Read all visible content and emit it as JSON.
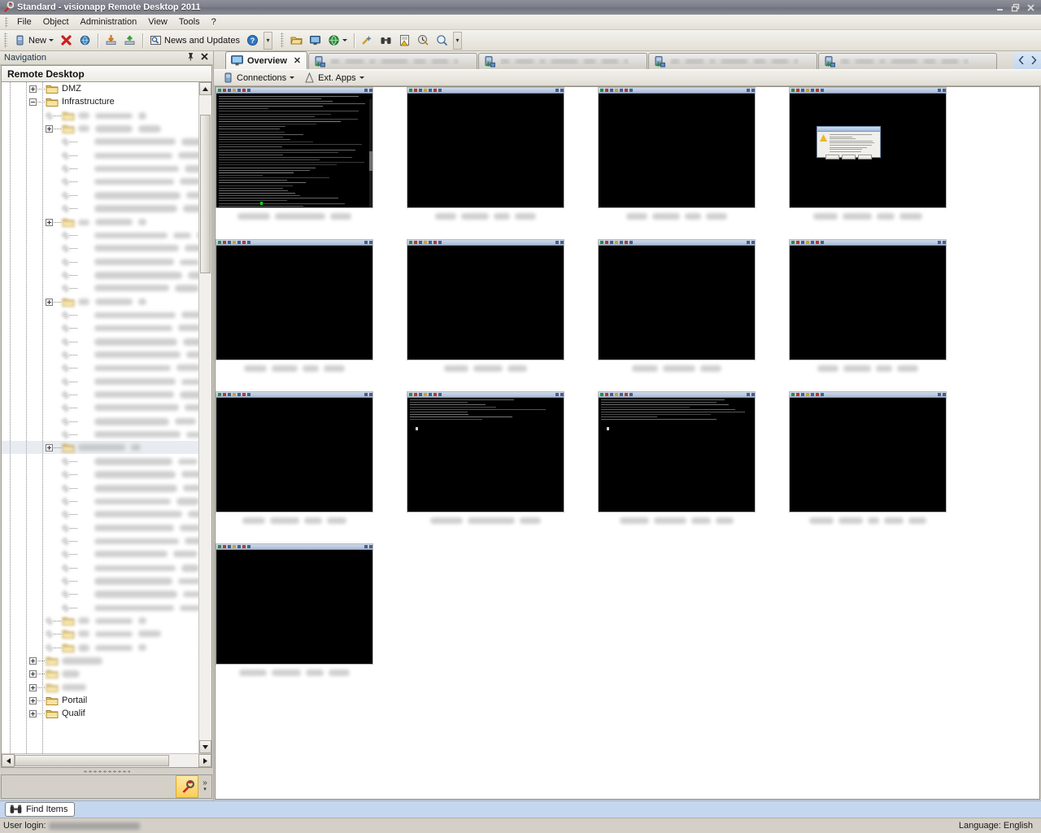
{
  "window": {
    "title": "Standard - visionapp Remote Desktop 2011",
    "app_icon": "wrench-icon",
    "buttons": {
      "minimize": "–",
      "restore": "❐",
      "close": "✕"
    }
  },
  "menubar": {
    "items": [
      {
        "label": "File"
      },
      {
        "label": "Object"
      },
      {
        "label": "Administration"
      },
      {
        "label": "View"
      },
      {
        "label": "Tools"
      },
      {
        "label": "?"
      }
    ]
  },
  "toolbar": {
    "groups": [
      {
        "buttons": [
          {
            "label": "New",
            "icon": "server-new-icon",
            "dropdown": true
          },
          {
            "label": "",
            "icon": "delete-red-x-icon"
          },
          {
            "label": "",
            "icon": "refresh-globe-icon"
          },
          {
            "label": "",
            "icon": "import-down-icon"
          },
          {
            "label": "",
            "icon": "export-up-icon"
          },
          {
            "label": "News and Updates",
            "icon": "news-magnifier-icon"
          },
          {
            "label": "",
            "icon": "help-question-icon"
          }
        ]
      },
      {
        "buttons": [
          {
            "label": "",
            "icon": "folder-open-icon"
          },
          {
            "label": "",
            "icon": "monitor-icon"
          },
          {
            "label": "",
            "icon": "globe-icon",
            "dropdown": true
          },
          {
            "label": "",
            "icon": "tools-wand-icon"
          },
          {
            "label": "",
            "icon": "binoculars-icon"
          },
          {
            "label": "",
            "icon": "report-warning-icon"
          },
          {
            "label": "",
            "icon": "history-clock-icon"
          },
          {
            "label": "",
            "icon": "search-globe-icon"
          }
        ]
      }
    ],
    "overflow_label": "»"
  },
  "navigation": {
    "caption": "Navigation",
    "pin_icon": "pin-icon",
    "close_icon": "close-icon",
    "header": "Remote Desktop",
    "tree": [
      {
        "id": "dmz",
        "label": "DMZ",
        "indent": 1,
        "expander": "plus",
        "icon": "folder-icon",
        "redacted": false
      },
      {
        "id": "infrastructure",
        "label": "Infrastructure",
        "indent": 1,
        "expander": "minus",
        "icon": "folder-icon",
        "redacted": false
      },
      {
        "id": "r1",
        "indent": 2,
        "expander": "none",
        "icon": "folder-yellow-icon",
        "redacted": true,
        "blobs": [
          14,
          46,
          10
        ]
      },
      {
        "id": "r2",
        "indent": 2,
        "expander": "plus",
        "icon": "folder-yellow-icon",
        "redacted": true,
        "blobs": [
          14,
          46,
          28
        ]
      },
      {
        "id": "r3",
        "indent": 3,
        "expander": "none",
        "icon": "connection-icon",
        "redacted": true,
        "blobs": [
          100,
          28
        ]
      },
      {
        "id": "r4",
        "indent": 3,
        "expander": "none",
        "icon": "connection-icon",
        "redacted": true,
        "blobs": [
          96,
          30
        ]
      },
      {
        "id": "r5",
        "indent": 3,
        "expander": "none",
        "icon": "connection-icon",
        "redacted": true,
        "blobs": [
          104,
          24
        ]
      },
      {
        "id": "r6",
        "indent": 3,
        "expander": "none",
        "icon": "connection-icon",
        "redacted": true,
        "blobs": [
          98,
          26
        ]
      },
      {
        "id": "r7",
        "indent": 3,
        "expander": "none",
        "icon": "connection-icon",
        "redacted": true,
        "blobs": [
          106,
          22
        ]
      },
      {
        "id": "r8",
        "indent": 3,
        "expander": "none",
        "icon": "connection-icon",
        "redacted": true,
        "blobs": [
          102,
          26
        ]
      },
      {
        "id": "r9",
        "indent": 2,
        "expander": "plus",
        "icon": "folder-yellow-icon",
        "redacted": true,
        "blobs": [
          14,
          46,
          10
        ]
      },
      {
        "id": "r10",
        "indent": 3,
        "expander": "none",
        "icon": "connection-icon",
        "redacted": true,
        "blobs": [
          90,
          22,
          26
        ]
      },
      {
        "id": "r11",
        "indent": 3,
        "expander": "none",
        "icon": "connection-icon",
        "redacted": true,
        "blobs": [
          104,
          22
        ]
      },
      {
        "id": "r12",
        "indent": 3,
        "expander": "none",
        "icon": "connection-icon",
        "redacted": true,
        "blobs": [
          98,
          24
        ]
      },
      {
        "id": "r13",
        "indent": 3,
        "expander": "none",
        "icon": "connection-icon",
        "redacted": true,
        "blobs": [
          108,
          20
        ]
      },
      {
        "id": "r14",
        "indent": 3,
        "expander": "none",
        "icon": "connection-icon",
        "redacted": true,
        "blobs": [
          92,
          30
        ]
      },
      {
        "id": "r15",
        "indent": 2,
        "expander": "plus",
        "icon": "folder-yellow-icon",
        "redacted": true,
        "blobs": [
          14,
          46,
          10
        ]
      },
      {
        "id": "r16",
        "indent": 3,
        "expander": "none",
        "icon": "connection-icon",
        "redacted": true,
        "blobs": [
          100,
          26
        ]
      },
      {
        "id": "r17",
        "indent": 3,
        "expander": "none",
        "icon": "connection-icon",
        "redacted": true,
        "blobs": [
          96,
          28
        ]
      },
      {
        "id": "r18",
        "indent": 3,
        "expander": "none",
        "icon": "connection-icon",
        "redacted": true,
        "blobs": [
          102,
          24
        ]
      },
      {
        "id": "r19",
        "indent": 3,
        "expander": "none",
        "icon": "connection-icon",
        "redacted": true,
        "blobs": [
          106,
          20
        ]
      },
      {
        "id": "r20",
        "indent": 3,
        "expander": "none",
        "icon": "connection-icon",
        "redacted": true,
        "blobs": [
          94,
          30
        ]
      },
      {
        "id": "r21",
        "indent": 3,
        "expander": "none",
        "icon": "connection-icon",
        "redacted": true,
        "blobs": [
          100,
          24
        ]
      },
      {
        "id": "r22",
        "indent": 3,
        "expander": "none",
        "icon": "connection-icon",
        "redacted": true,
        "blobs": [
          98,
          28
        ]
      },
      {
        "id": "r23",
        "indent": 3,
        "expander": "none",
        "icon": "connection-icon",
        "redacted": true,
        "blobs": [
          104,
          22
        ]
      },
      {
        "id": "r24",
        "indent": 3,
        "expander": "none",
        "icon": "connection-icon",
        "redacted": true,
        "blobs": [
          92,
          26
        ]
      },
      {
        "id": "r25",
        "indent": 3,
        "expander": "none",
        "icon": "connection-icon",
        "redacted": true,
        "blobs": [
          106,
          24
        ]
      },
      {
        "id": "r26",
        "indent": 2,
        "expander": "plus",
        "icon": "folder-yellow-icon",
        "redacted": true,
        "selected": true,
        "blobs": [
          58,
          12
        ]
      },
      {
        "id": "r27",
        "indent": 3,
        "expander": "none",
        "icon": "connection-icon",
        "redacted": true,
        "blobs": [
          96,
          24
        ]
      },
      {
        "id": "r28",
        "indent": 3,
        "expander": "none",
        "icon": "connection-icon",
        "redacted": true,
        "blobs": [
          100,
          26
        ]
      },
      {
        "id": "r29",
        "indent": 3,
        "expander": "none",
        "icon": "connection-icon",
        "redacted": true,
        "blobs": [
          102,
          22
        ]
      },
      {
        "id": "r30",
        "indent": 3,
        "expander": "none",
        "icon": "connection-icon",
        "redacted": true,
        "blobs": [
          94,
          28
        ]
      },
      {
        "id": "r31",
        "indent": 3,
        "expander": "none",
        "icon": "connection-icon",
        "redacted": true,
        "blobs": [
          108,
          20
        ]
      },
      {
        "id": "r32",
        "indent": 3,
        "expander": "none",
        "icon": "connection-icon",
        "redacted": true,
        "blobs": [
          98,
          26
        ]
      },
      {
        "id": "r33",
        "indent": 3,
        "expander": "none",
        "icon": "connection-icon",
        "redacted": true,
        "blobs": [
          104,
          24
        ]
      },
      {
        "id": "r34",
        "indent": 3,
        "expander": "none",
        "icon": "connection-icon",
        "redacted": true,
        "blobs": [
          90,
          30
        ]
      },
      {
        "id": "r35",
        "indent": 3,
        "expander": "none",
        "icon": "connection-icon",
        "redacted": true,
        "blobs": [
          100,
          22
        ]
      },
      {
        "id": "r36",
        "indent": 3,
        "expander": "none",
        "icon": "connection-icon",
        "redacted": true,
        "blobs": [
          96,
          28
        ]
      },
      {
        "id": "r37",
        "indent": 3,
        "expander": "none",
        "icon": "connection-icon",
        "redacted": true,
        "blobs": [
          102,
          24
        ]
      },
      {
        "id": "r38",
        "indent": 3,
        "expander": "none",
        "icon": "connection-icon",
        "redacted": true,
        "blobs": [
          98,
          26
        ]
      },
      {
        "id": "r39",
        "indent": 2,
        "expander": "none",
        "icon": "folder-yellow-icon",
        "redacted": true,
        "blobs": [
          14,
          46,
          10
        ]
      },
      {
        "id": "r40",
        "indent": 2,
        "expander": "none",
        "icon": "folder-yellow-icon",
        "redacted": true,
        "blobs": [
          14,
          46,
          28
        ]
      },
      {
        "id": "r41",
        "indent": 2,
        "expander": "none",
        "icon": "folder-yellow-icon",
        "redacted": true,
        "blobs": [
          14,
          46,
          10
        ]
      },
      {
        "id": "r42",
        "indent": 1,
        "expander": "plus",
        "icon": "folder-yellow-icon",
        "redacted": true,
        "blobs": [
          50
        ]
      },
      {
        "id": "r43",
        "indent": 1,
        "expander": "plus",
        "icon": "folder-yellow-icon",
        "redacted": true,
        "blobs": [
          22
        ]
      },
      {
        "id": "r44",
        "indent": 1,
        "expander": "plus",
        "icon": "folder-yellow-icon",
        "redacted": true,
        "blobs": [
          30
        ]
      },
      {
        "id": "portail",
        "label": "Portail",
        "indent": 1,
        "expander": "plus",
        "icon": "folder-icon",
        "redacted": false
      },
      {
        "id": "qualif",
        "label": "Qualif",
        "indent": 1,
        "expander": "plus",
        "icon": "folder-icon",
        "redacted": false
      }
    ],
    "bottom_slot_icon": "wrench-icon",
    "bottom_overflow": "»"
  },
  "tabs": {
    "items": [
      {
        "label": "Overview",
        "icon": "monitor-icon",
        "active": true,
        "closable": true,
        "redacted": false
      },
      {
        "label": "",
        "icon": "rdp-session-icon",
        "active": false,
        "closable": false,
        "redacted": true
      },
      {
        "label": "",
        "icon": "rdp-session-icon",
        "active": false,
        "closable": false,
        "redacted": true
      },
      {
        "label": "",
        "icon": "rdp-session-icon",
        "active": false,
        "closable": false,
        "redacted": true
      },
      {
        "label": "",
        "icon": "rdp-session-icon",
        "active": false,
        "closable": false,
        "redacted": true
      }
    ],
    "nav_prev_icon": "chevron-left-icon",
    "nav_next_icon": "chevron-right-icon"
  },
  "commandbar": {
    "items": [
      {
        "label": "Connections",
        "icon": "server-icon",
        "dropdown": true
      },
      {
        "label": "Ext. Apps",
        "icon": "ext-app-icon",
        "dropdown": true
      }
    ]
  },
  "overview": {
    "thumbnails": [
      {
        "id": "t1",
        "row": 0,
        "col": 0,
        "content": "console-text",
        "caption_blobs": [
          40,
          62,
          26
        ]
      },
      {
        "id": "t2",
        "row": 0,
        "col": 1,
        "content": "blank",
        "caption_blobs": [
          26,
          34,
          20,
          26
        ]
      },
      {
        "id": "t3",
        "row": 0,
        "col": 2,
        "content": "blank",
        "caption_blobs": [
          26,
          34,
          20,
          26
        ]
      },
      {
        "id": "t4",
        "row": 0,
        "col": 3,
        "content": "dialog",
        "caption_blobs": [
          30,
          36,
          22,
          28
        ]
      },
      {
        "id": "t5",
        "row": 1,
        "col": 0,
        "content": "blank",
        "caption_blobs": [
          28,
          32,
          20,
          26
        ]
      },
      {
        "id": "t6",
        "row": 1,
        "col": 1,
        "content": "blank",
        "caption_blobs": [
          30,
          36,
          24
        ]
      },
      {
        "id": "t7",
        "row": 1,
        "col": 2,
        "content": "blank",
        "caption_blobs": [
          32,
          40,
          26
        ]
      },
      {
        "id": "t8",
        "row": 1,
        "col": 3,
        "content": "blank",
        "caption_blobs": [
          26,
          34,
          20,
          26
        ]
      },
      {
        "id": "t9",
        "row": 2,
        "col": 0,
        "content": "blank",
        "caption_blobs": [
          28,
          36,
          22,
          24
        ]
      },
      {
        "id": "t10",
        "row": 2,
        "col": 1,
        "content": "console-short",
        "caption_blobs": [
          40,
          58,
          26
        ]
      },
      {
        "id": "t11",
        "row": 2,
        "col": 2,
        "content": "console-short",
        "caption_blobs": [
          36,
          40,
          24,
          22
        ]
      },
      {
        "id": "t12",
        "row": 2,
        "col": 3,
        "content": "blank",
        "caption_blobs": [
          30,
          30,
          14,
          24,
          22
        ]
      },
      {
        "id": "t13",
        "row": 3,
        "col": 0,
        "content": "blank",
        "caption_blobs": [
          34,
          36,
          22,
          26
        ]
      }
    ]
  },
  "findbar": {
    "label": "Find Items",
    "icon": "binoculars-icon"
  },
  "statusbar": {
    "user_login_label": "User login:",
    "user_login_value_redacted": true,
    "language": "Language: English"
  },
  "colors": {
    "accent_blue": "#c5d6ef",
    "chrome": "#d4d0c8",
    "title_gradient_top": "#8d9099",
    "console_black": "#000000",
    "selection_yellow": "#fbcd54"
  }
}
